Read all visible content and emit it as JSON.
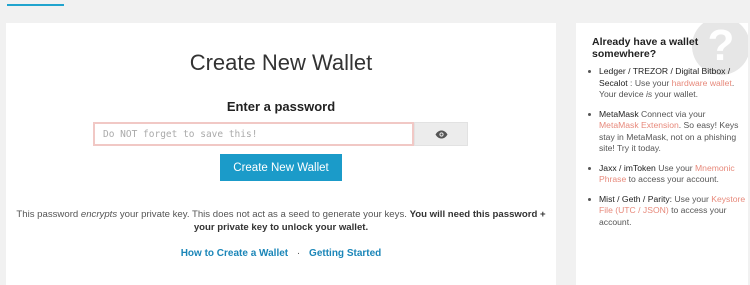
{
  "main": {
    "title": "Create New Wallet",
    "password_label": "Enter a password",
    "password_placeholder": "Do NOT forget to save this!",
    "eye_icon": "eye-icon",
    "create_button": "Create New Wallet",
    "info_part1": "This password ",
    "info_em": "encrypts",
    "info_part2": " your private key. This does not act as a seed to generate your keys. ",
    "info_bold": "You will need this password + your private key to unlock your wallet.",
    "link_how": "How to Create a Wallet",
    "link_sep": "·",
    "link_getting_started": "Getting Started"
  },
  "sidebar": {
    "help_icon": "question-mark-icon",
    "title": "Already have a wallet somewhere?",
    "items": [
      {
        "strong": "Ledger / TREZOR / Digital Bitbox / Secalot",
        "pre": " : Use your ",
        "link": "hardware wallet",
        "post": ". Your device ",
        "em": "is",
        "post2": " your wallet."
      },
      {
        "strong": "MetaMask",
        "pre": " Connect via your ",
        "link": "MetaMask Extension",
        "post": ". So easy! Keys stay in MetaMask, not on a phishing site! Try it today."
      },
      {
        "strong": "Jaxx / imToken",
        "pre": " Use your ",
        "link": "Mnemonic Phrase",
        "post": " to access your account."
      },
      {
        "strong": "Mist / Geth / Parity:",
        "pre": " Use your ",
        "link": "Keystore File (UTC / JSON)",
        "post": " to access your account."
      }
    ]
  },
  "colors": {
    "accent": "#1b9bc9",
    "link_orange": "#e7897b",
    "input_border": "#f1c8c5"
  }
}
